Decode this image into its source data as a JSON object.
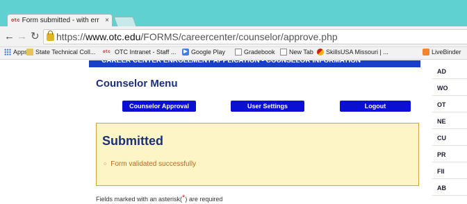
{
  "browser": {
    "tab_title": "Form submitted - with err",
    "tab_favicon": "otc",
    "tab_close": "×",
    "url_scheme": "https://",
    "url_host": "www.otc.edu",
    "url_path": "/FORMS/careercenter/counselor/approve.php"
  },
  "bookmarks": [
    {
      "label": "Apps",
      "icon": "apps-grid-icon"
    },
    {
      "label": "State Technical Coll...",
      "icon": "folder-icon"
    },
    {
      "label": "OTC Intranet - Staff ...",
      "icon": "otc-favicon"
    },
    {
      "label": "Google Play",
      "icon": "google-play-icon"
    },
    {
      "label": "Gradebook",
      "icon": "page-icon"
    },
    {
      "label": "New Tab",
      "icon": "page-icon"
    },
    {
      "label": "SkillsUSA Missouri | ...",
      "icon": "skillsusa-icon"
    },
    {
      "label": "LiveBinder",
      "icon": "livebinder-icon"
    }
  ],
  "page": {
    "banner": "CAREER CENTER ENROLLMENT APPLICATION - COUNSELOR INFORMATION",
    "menu_heading": "Counselor Menu",
    "buttons": {
      "approval": "Counselor Approval",
      "settings": "User Settings",
      "logout": "Logout"
    },
    "submitted": {
      "title": "Submitted",
      "bullet": "○",
      "message": "Form validated successfully"
    },
    "required_note": {
      "before": "Fields marked with an asterisk(",
      "asterisk": "*",
      "after": ") are required"
    },
    "sidebar": [
      "AD",
      "WO",
      "OT",
      "NE",
      "CU",
      "PR",
      "FII",
      "AB"
    ]
  },
  "colors": {
    "tabstrip": "#5fd1d0",
    "banner": "#1a3fc8",
    "menu_button": "#0b0fd4",
    "heading": "#1b2f7a",
    "notice_bg": "#fdf5c6",
    "notice_border": "#cfa63a",
    "notice_text": "#b86a1a"
  }
}
